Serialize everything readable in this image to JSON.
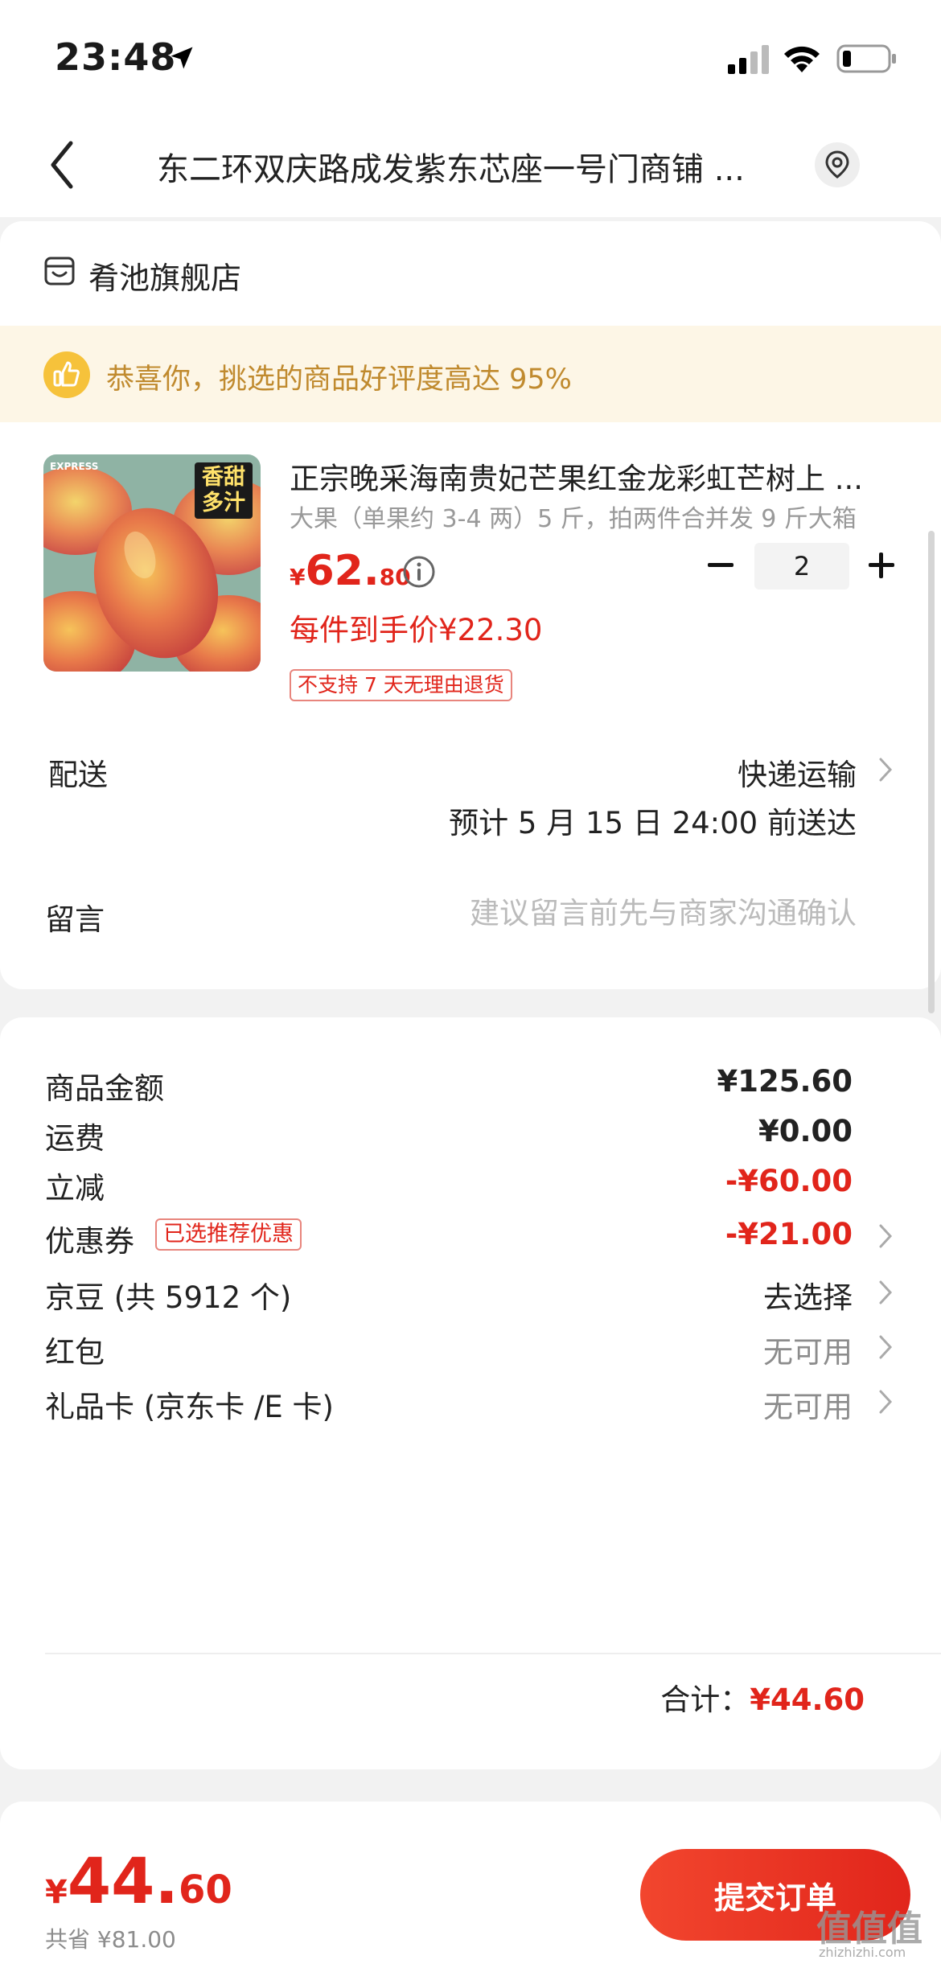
{
  "status_bar": {
    "time": "23:48"
  },
  "nav": {
    "title": "东二环双庆路成发紫东芯座一号门商铺 ..."
  },
  "shop": {
    "name": "肴池旗舰店"
  },
  "banner": {
    "text": "恭喜你，挑选的商品好评度高达 95%"
  },
  "product": {
    "title": "正宗晚采海南贵妃芒果红金龙彩虹芒树上 ...",
    "spec": "大果（单果约 3-4 两）5 斤，拍两件合并发 9 斤大箱",
    "badge_line1": "香甜",
    "badge_line2": "多汁",
    "express_tag": "EXPRESS",
    "price_symbol": "¥",
    "price_int": "62.",
    "price_dec": "80",
    "quantity": "2",
    "unit_price": "每件到手价¥22.30",
    "return_tag": "不支持 7 天无理由退货"
  },
  "delivery": {
    "label": "配送",
    "method": "快递运输",
    "eta": "预计 5 月 15 日 24:00 前送达"
  },
  "note": {
    "label": "留言",
    "placeholder": "建议留言前先与商家沟通确认"
  },
  "fees": {
    "goods_label": "商品金额",
    "goods_value": "¥125.60",
    "shipping_label": "运费",
    "shipping_value": "¥0.00",
    "discount_label": "立减",
    "discount_value": "-¥60.00",
    "coupon_label": "优惠券",
    "coupon_tag": "已选推荐优惠",
    "coupon_value": "-¥21.00",
    "jingdou_label": "京豆 (共 5912 个)",
    "jingdou_value": "去选择",
    "redpacket_label": "红包",
    "redpacket_value": "无可用",
    "giftcard_label": "礼品卡 (京东卡 /E 卡)",
    "giftcard_value": "无可用",
    "total_label": "合计：",
    "total_value": "¥44.60"
  },
  "footer": {
    "price_symbol": "¥",
    "price_int": "44.",
    "price_dec": "60",
    "saved": "共省 ¥81.00",
    "submit_label": "提交订单"
  },
  "watermark": {
    "text": "值值值",
    "sub": "zhizhizhi.com"
  },
  "colors": {
    "accent_red": "#e1251b",
    "banner_bg": "#fdf6e6",
    "banner_text": "#c08a2e"
  },
  "icons": [
    "location-arrow-icon",
    "signal-icon",
    "wifi-icon",
    "battery-icon",
    "back-chevron-icon",
    "location-pin-icon",
    "shop-icon",
    "thumbs-up-icon",
    "info-icon",
    "minus-icon",
    "plus-icon",
    "chevron-right-icon"
  ]
}
